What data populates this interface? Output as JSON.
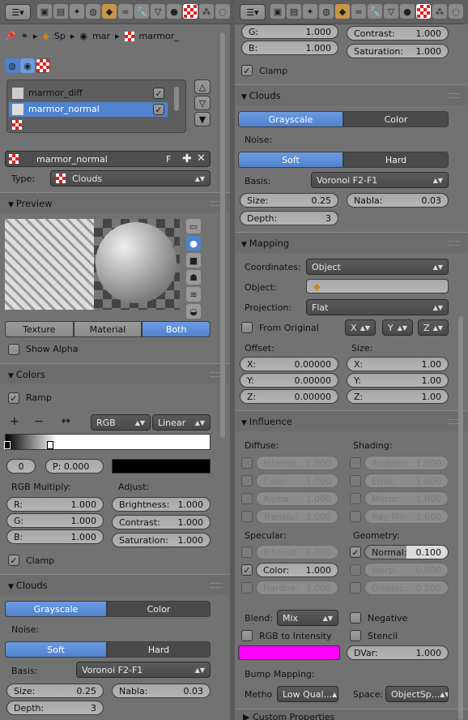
{
  "left": {
    "breadcrumb": [
      "Sp",
      "mar",
      "marmor_"
    ],
    "textures": [
      {
        "label": "marmor_diff",
        "checked": true
      },
      {
        "label": "marmor_normal",
        "checked": true,
        "selected": true
      },
      {
        "label": ""
      }
    ],
    "tex_name": "marmor_normal",
    "tex_f": "F",
    "type_label": "Type:",
    "type_value": "Clouds",
    "preview_title": "Preview",
    "preview_tabs": [
      "Texture",
      "Material",
      "Both"
    ],
    "show_alpha": "Show Alpha",
    "colors_title": "Colors",
    "ramp": "Ramp",
    "ramp_mode": "RGB",
    "ramp_interp": "Linear",
    "ramp_index": "0",
    "ramp_pos": "P: 0.000",
    "rgb_mult_label": "RGB Multiply:",
    "adjust_label": "Adjust:",
    "r": {
      "l": "R:",
      "v": "1.000"
    },
    "g": {
      "l": "G:",
      "v": "1.000"
    },
    "b": {
      "l": "B:",
      "v": "1.000"
    },
    "brightness": {
      "l": "Brightness:",
      "v": "1.000"
    },
    "contrast": {
      "l": "Contrast:",
      "v": "1.000"
    },
    "saturation": {
      "l": "Saturation:",
      "v": "1.000"
    },
    "clamp": "Clamp",
    "clouds_title": "Clouds",
    "grayscale": "Grayscale",
    "color": "Color",
    "noise_label": "Noise:",
    "soft": "Soft",
    "hard": "Hard",
    "basis_label": "Basis:",
    "basis_value": "Voronoi F2-F1",
    "size": {
      "l": "Size:",
      "v": "0.25"
    },
    "nabla": {
      "l": "Nabla:",
      "v": "0.03"
    },
    "depth": {
      "l": "Depth:",
      "v": "3"
    }
  },
  "right": {
    "g": {
      "l": "G:",
      "v": "1.000"
    },
    "b": {
      "l": "B:",
      "v": "1.000"
    },
    "contrast": {
      "l": "Contrast:",
      "v": "1.000"
    },
    "saturation": {
      "l": "Saturation:",
      "v": "1.000"
    },
    "clamp": "Clamp",
    "clouds_title": "Clouds",
    "grayscale": "Grayscale",
    "color": "Color",
    "noise_label": "Noise:",
    "soft": "Soft",
    "hard": "Hard",
    "basis_label": "Basis:",
    "basis_value": "Voronoi F2-F1",
    "size": {
      "l": "Size:",
      "v": "0.25"
    },
    "nabla": {
      "l": "Nabla:",
      "v": "0.03"
    },
    "depth": {
      "l": "Depth:",
      "v": "3"
    },
    "mapping_title": "Mapping",
    "coordinates_label": "Coordinates:",
    "coordinates_value": "Object",
    "object_label": "Object:",
    "projection_label": "Projection:",
    "projection_value": "Flat",
    "from_original": "From Original",
    "axes": [
      "X",
      "Y",
      "Z"
    ],
    "offset_label": "Offset:",
    "size_label": "Size:",
    "offset": [
      {
        "l": "X:",
        "v": "0.00000"
      },
      {
        "l": "Y:",
        "v": "0.00000"
      },
      {
        "l": "Z:",
        "v": "0.00000"
      }
    ],
    "sizes": [
      {
        "l": "X:",
        "v": "1.00"
      },
      {
        "l": "Y:",
        "v": "1.00"
      },
      {
        "l": "Z:",
        "v": "1.00"
      }
    ],
    "influence_title": "Influence",
    "diffuse_label": "Diffuse:",
    "shading_label": "Shading:",
    "diffuse": [
      {
        "l": "Intensit:",
        "v": "1.000"
      },
      {
        "l": "Color:",
        "v": "1.000"
      },
      {
        "l": "Alpha:",
        "v": "1.000"
      },
      {
        "l": "Translu:",
        "v": "1.000"
      }
    ],
    "shading": [
      {
        "l": "Ambien:",
        "v": "1.000"
      },
      {
        "l": "Emit:",
        "v": "1.000"
      },
      {
        "l": "Mirror:",
        "v": "1.000"
      },
      {
        "l": "Ray Mir:",
        "v": "1.000"
      }
    ],
    "specular_label": "Specular:",
    "geometry_label": "Geometry:",
    "specular": [
      {
        "l": "Intensit:",
        "v": "1.000"
      },
      {
        "l": "Color:",
        "v": "1.000"
      },
      {
        "l": "Hardne:",
        "v": "1.000"
      }
    ],
    "geometry": [
      {
        "l": "Normal:",
        "v": "0.100"
      },
      {
        "l": "Warp:",
        "v": "0.000"
      },
      {
        "l": "Displac:",
        "v": "0.200"
      }
    ],
    "blend_label": "Blend:",
    "blend_value": "Mix",
    "negative": "Negative",
    "rgb_to_intensity": "RGB to Intensity",
    "stencil": "Stencil",
    "dvar": {
      "l": "DVar:",
      "v": "1.000"
    },
    "bump_label": "Bump Mapping:",
    "method_label": "Metho",
    "method_value": "Low Qual...",
    "space_label": "Space:",
    "space_value": "ObjectSp...",
    "custom_props": "Custom Properties"
  },
  "colors": {
    "accent": "#5083cf",
    "magenta": "#ff00ff",
    "panel": "#727272"
  }
}
